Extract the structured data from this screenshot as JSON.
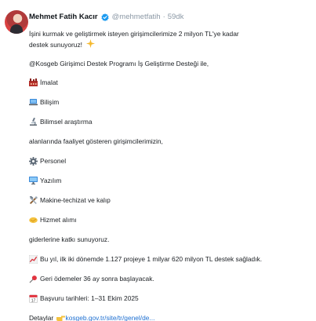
{
  "author": {
    "name": "Mehmet Fatih Kacır",
    "handle": "@mehmetfatih",
    "time": "59dk"
  },
  "tweet": {
    "intro_line1": "İşini kurmak ve geliştirmek isteyen girişimcilerimize 2 milyon TL'ye kadar",
    "intro_line2": "destek sunuyoruz!",
    "program": "@Kosgeb Girişimci Destek Programı İş Geliştirme Desteği ile,",
    "sector_1": "İmalat",
    "sector_2": "Bilişim",
    "sector_3": "Bilimsel araştırma",
    "sectors_outro": "alanlarında faaliyet gösteren girişimcilerimizin,",
    "expense_1": "Personel",
    "expense_2": "Yazılım",
    "expense_3": "Makine-techizat ve kalıp",
    "expense_4": "Hizmet alımı",
    "expenses_outro": "giderlerine katkı sunuyoruz.",
    "stat": "Bu yıl, ilk iki dönemde 1.127 projeye 1 milyar 620 milyon TL destek sağladık.",
    "repayment": "Geri ödemeler 36 ay sonra başlayacak.",
    "dates": "Başvuru tarihleri: 1–31 Ekim 2025",
    "details_label": "Detaylar",
    "details_link": "kosgeb.gov.tr/site/tr/genel/de..."
  },
  "icons": {
    "sparkle": "sparkles-emoji",
    "factory": "factory-emoji",
    "laptop": "laptop-emoji",
    "microscope": "microscope-emoji",
    "gear": "gear-emoji",
    "computer": "desktop-emoji",
    "tools": "hammer-wrench-emoji",
    "handshake": "handshake-emoji",
    "chart": "chart-increasing-emoji",
    "pin": "pushpin-emoji",
    "calendar": "calendar-emoji",
    "pointing": "pointing-hand-emoji"
  },
  "colors": {
    "link": "#1d6fd1",
    "verified": "#1d9bf0",
    "muted": "#8b98a5"
  }
}
